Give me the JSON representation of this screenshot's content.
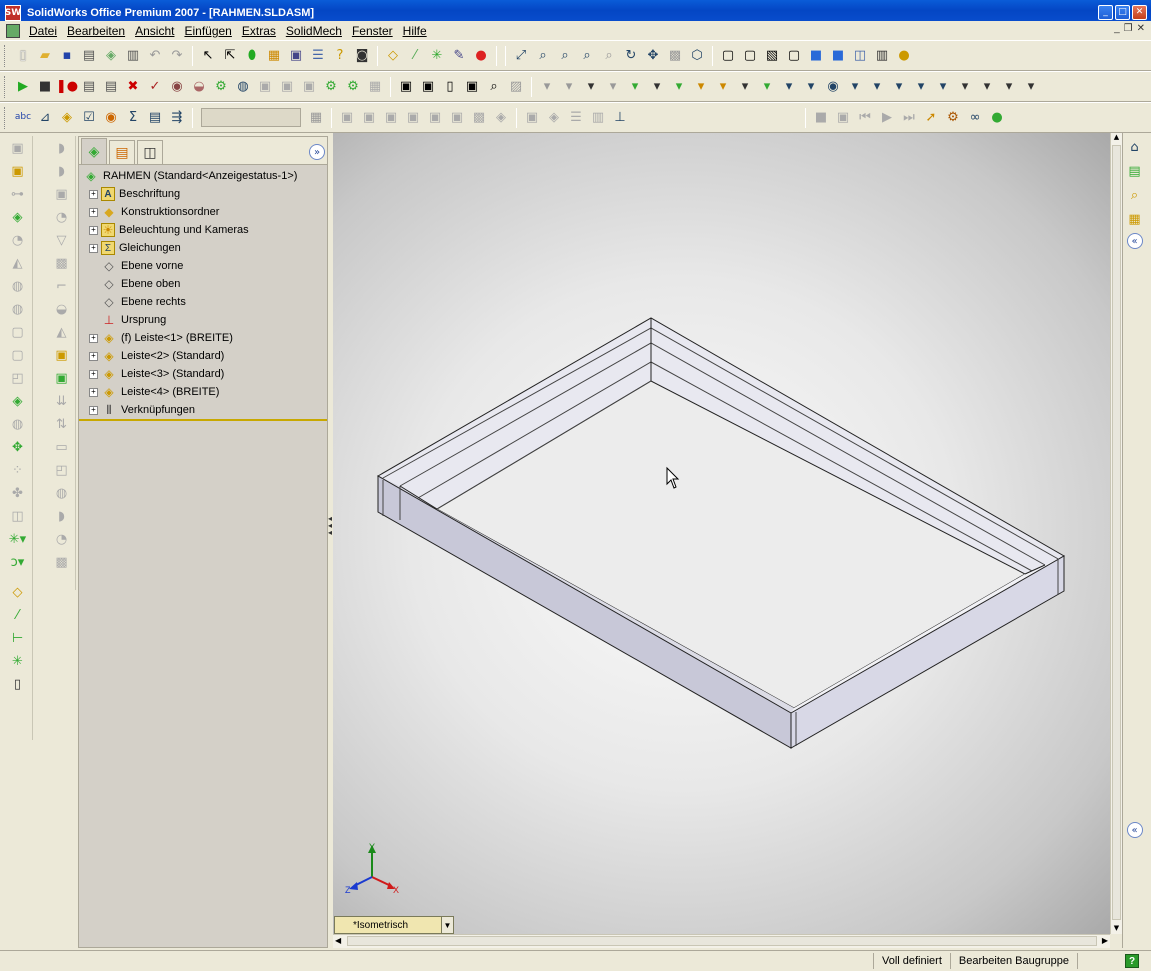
{
  "window": {
    "title": "SolidWorks Office Premium 2007 - [RAHMEN.SLDASM]",
    "logo_text": "SW"
  },
  "menu": {
    "items": [
      "Datei",
      "Bearbeiten",
      "Ansicht",
      "Einfügen",
      "Extras",
      "SolidMech",
      "Fenster",
      "Hilfe"
    ]
  },
  "tree": {
    "root": "RAHMEN  (Standard<Anzeigestatus-1>)",
    "items": [
      {
        "label": "Beschriftung",
        "icon": "annotation-icon",
        "expandable": true
      },
      {
        "label": "Konstruktionsordner",
        "icon": "design-folder-icon",
        "expandable": true
      },
      {
        "label": "Beleuchtung und Kameras",
        "icon": "lights-cameras-icon",
        "expandable": true
      },
      {
        "label": "Gleichungen",
        "icon": "equations-icon",
        "expandable": true
      },
      {
        "label": "Ebene vorne",
        "icon": "plane-icon",
        "expandable": false
      },
      {
        "label": "Ebene oben",
        "icon": "plane-icon",
        "expandable": false
      },
      {
        "label": "Ebene rechts",
        "icon": "plane-icon",
        "expandable": false
      },
      {
        "label": "Ursprung",
        "icon": "origin-icon",
        "expandable": false
      },
      {
        "label": "(f) Leiste<1> (BREITE)",
        "icon": "part-icon",
        "expandable": true
      },
      {
        "label": "Leiste<2> (Standard)",
        "icon": "part-icon",
        "expandable": true
      },
      {
        "label": "Leiste<3> (Standard)",
        "icon": "part-icon",
        "expandable": true
      },
      {
        "label": "Leiste<4> (BREITE)",
        "icon": "part-icon",
        "expandable": true
      },
      {
        "label": "Verknüpfungen",
        "icon": "mates-icon",
        "expandable": true
      }
    ]
  },
  "viewport": {
    "view_name": "*Isometrisch",
    "triad": {
      "x": "X",
      "y": "Y",
      "z": "Z"
    }
  },
  "status": {
    "state": "Voll definiert",
    "mode": "Bearbeiten Baugruppe",
    "help": "?"
  },
  "colors": {
    "title_blue": "#0a5cd8",
    "frame_face": "#e4e4ee",
    "frame_dark": "#b4b4c8"
  }
}
